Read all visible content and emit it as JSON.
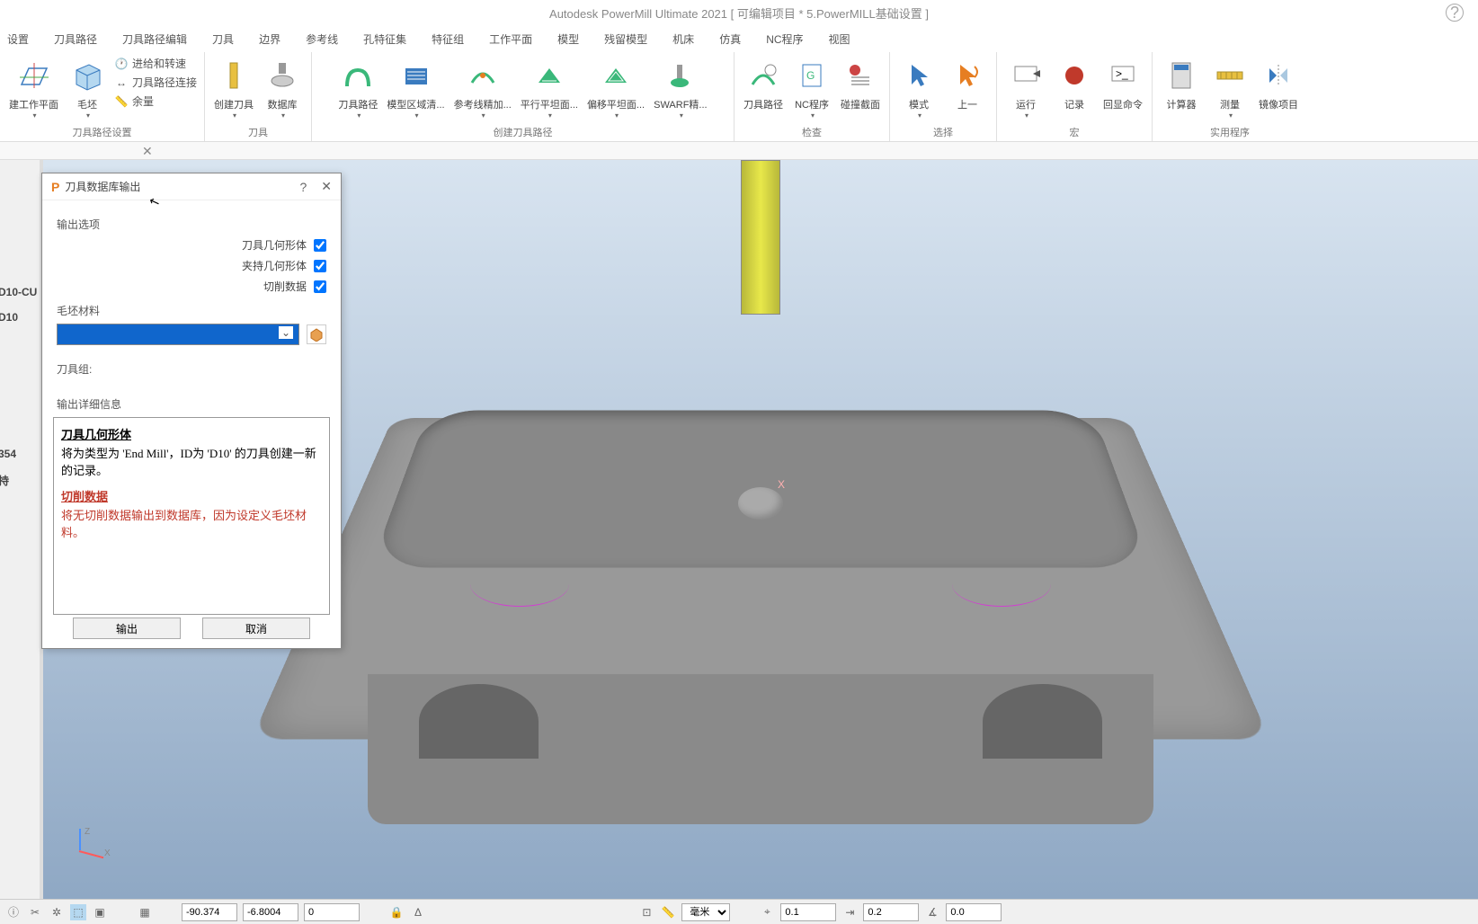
{
  "app_title": "Autodesk PowerMill Ultimate 2021    [ 可编辑项目 * 5.PowerMILL基础设置 ]",
  "menu": {
    "items": [
      "设置",
      "刀具路径",
      "刀具路径编辑",
      "刀具",
      "边界",
      "参考线",
      "孔特征集",
      "特征组",
      "工作平面",
      "模型",
      "残留模型",
      "机床",
      "仿真",
      "NC程序",
      "视图"
    ]
  },
  "ribbon": {
    "groups": [
      {
        "label": "刀具路径设置",
        "items": [
          "建工作平面",
          "毛坯"
        ],
        "small": [
          "进给和转速",
          "刀具路径连接",
          "余量"
        ]
      },
      {
        "label": "刀具",
        "items": [
          "创建刀具",
          "数据库"
        ]
      },
      {
        "label": "创建刀具路径",
        "items": [
          "刀具路径",
          "模型区域清...",
          "参考线精加...",
          "平行平坦面...",
          "偏移平坦面...",
          "SWARF精..."
        ]
      },
      {
        "label": "检查",
        "items": [
          "刀具路径",
          "NC程序",
          "碰撞截面"
        ]
      },
      {
        "label": "选择",
        "items": [
          "模式",
          "上一"
        ]
      },
      {
        "label": "宏",
        "items": [
          "运行",
          "记录",
          "回显命令"
        ]
      },
      {
        "label": "实用程序",
        "items": [
          "计算器",
          "测量",
          "镜像项目"
        ]
      }
    ]
  },
  "left_tree": {
    "a": "D10-CU",
    "b": "D10",
    "c": "354",
    "d": "持"
  },
  "dialog": {
    "title": "刀具数据库输出",
    "section_options": "输出选项",
    "chk_tool_geom": "刀具几何形体",
    "chk_holder_geom": "夹持几何形体",
    "chk_cutting_data": "切削数据",
    "material_label": "毛坯材料",
    "tool_group_label": "刀具组:",
    "detail_title": "输出详细信息",
    "detail_h1": "刀具几何形体",
    "detail_t1": "将为类型为 'End Mill'，ID为 'D10' 的刀具创建一新的记录。",
    "detail_h2": "切削数据",
    "detail_t2": "将无切削数据输出到数据库，因为设定义毛坯材料。",
    "btn_export": "输出",
    "btn_cancel": "取消",
    "help": "?",
    "close": "✕"
  },
  "viewport": {
    "x_label": "X",
    "z_ax": "Z",
    "x_ax": "X"
  },
  "bottom": {
    "coord_x": "-90.374",
    "coord_y": "-6.8004",
    "coord_z": "0",
    "unit": "毫米",
    "tol": "0.1",
    "step": "0.2",
    "angle": "0.0"
  },
  "tab_close": "✕"
}
